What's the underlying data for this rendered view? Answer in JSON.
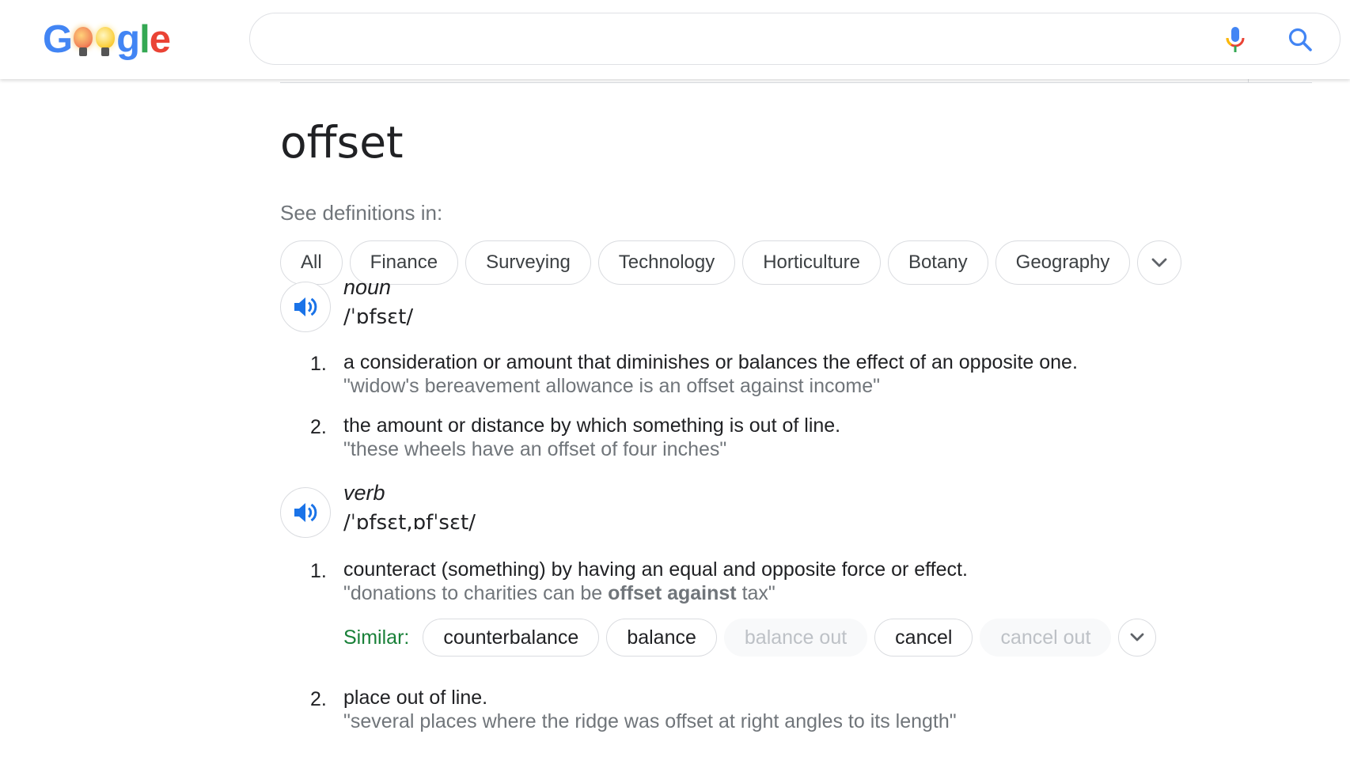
{
  "header": {
    "logo_letters": [
      "G",
      "g",
      "l",
      "e"
    ],
    "search_value": "",
    "colors": {
      "blue": "#4285f4",
      "red": "#ea4335",
      "yellow": "#fbbc05",
      "green": "#34a853"
    }
  },
  "main": {
    "word": "offset",
    "see_definitions_label": "See definitions in:",
    "domain_chips": [
      "All",
      "Finance",
      "Surveying",
      "Technology",
      "Horticulture",
      "Botany",
      "Geography"
    ],
    "entries": [
      {
        "pos": "noun",
        "phonetic": "/ˈɒfsɛt/",
        "senses": [
          {
            "num": "1.",
            "definition": "a consideration or amount that diminishes or balances the effect of an opposite one.",
            "example": "\"widow's bereavement allowance is an offset against income\""
          },
          {
            "num": "2.",
            "definition": "the amount or distance by which something is out of line.",
            "example": "\"these wheels have an offset of four inches\""
          }
        ]
      },
      {
        "pos": "verb",
        "phonetic": "/ˈɒfsɛt,ɒfˈsɛt/",
        "senses": [
          {
            "num": "1.",
            "definition": "counteract (something) by having an equal and opposite force or effect.",
            "example_pre": "\"donations to charities can be ",
            "example_bold": "offset against",
            "example_post": " tax\""
          },
          {
            "num": "2.",
            "definition": "place out of line.",
            "example": "\"several places where the ridge was offset at right angles to its length\""
          }
        ]
      }
    ],
    "similar": {
      "label": "Similar:",
      "words": [
        "counterbalance",
        "balance",
        "balance out",
        "cancel",
        "cancel out"
      ]
    }
  }
}
